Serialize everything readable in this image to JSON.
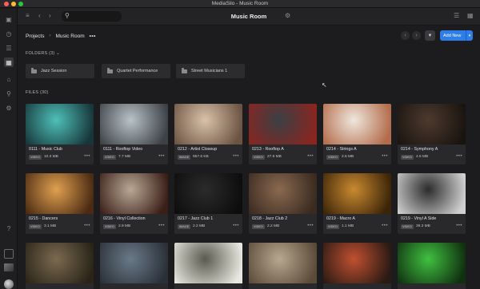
{
  "window": {
    "title": "MediaSilo - Music Room"
  },
  "topbar": {
    "room_title": "Music Room",
    "search_placeholder": ""
  },
  "breadcrumbs": {
    "items": [
      "Projects",
      "Music Room"
    ],
    "more": "•••"
  },
  "toolbar": {
    "add_new_label": "Add New"
  },
  "folders": {
    "header": "FOLDERS (3)",
    "items": [
      "Jazz Session",
      "Quartet Performance",
      "Street Musicians 1"
    ]
  },
  "files": {
    "header": "FILES (30)",
    "items": [
      {
        "title": "0111 - Music Club",
        "type": "VIDEO",
        "size": "10.3 MB",
        "colors": [
          "#4ec0b8",
          "#17363a"
        ]
      },
      {
        "title": "0111 - Rooftop Video",
        "type": "VIDEO",
        "size": "7.7 MB",
        "colors": [
          "#b9c3c8",
          "#3c4146"
        ]
      },
      {
        "title": "0212 - Artist Closeup",
        "type": "IMAGE",
        "size": "957.6 KB",
        "colors": [
          "#d9c2a8",
          "#6b5342"
        ]
      },
      {
        "title": "0213 - Rooftop A",
        "type": "VIDEO",
        "size": "27.6 MB",
        "colors": [
          "#3a4045",
          "#8a2520"
        ]
      },
      {
        "title": "0214 - Strings A",
        "type": "VIDEO",
        "size": "2.6 MB",
        "colors": [
          "#efe7dd",
          "#b36b4a"
        ]
      },
      {
        "title": "0214 - Symphony A",
        "type": "VIDEO",
        "size": "4.5 MB",
        "colors": [
          "#4d3a2e",
          "#1a1410"
        ]
      },
      {
        "title": "0215 - Dancers",
        "type": "VIDEO",
        "size": "3.1 MB",
        "colors": [
          "#e0a050",
          "#4a2a12"
        ]
      },
      {
        "title": "0216 - Vinyl Collection",
        "type": "VIDEO",
        "size": "2.9 MB",
        "colors": [
          "#b9a894",
          "#3a1e18"
        ]
      },
      {
        "title": "0217 - Jazz Club 1",
        "type": "IMAGE",
        "size": "2.2 MB",
        "colors": [
          "#2b2b2b",
          "#0d0d0d"
        ]
      },
      {
        "title": "0218 - Jazz Club 2",
        "type": "VIDEO",
        "size": "2.2 MB",
        "colors": [
          "#8a6a50",
          "#3a2a20"
        ]
      },
      {
        "title": "0219 - Macro A",
        "type": "VIDEO",
        "size": "1.1 MB",
        "colors": [
          "#c98a30",
          "#3c2408"
        ]
      },
      {
        "title": "0219 - Vinyl A Side",
        "type": "VIDEO",
        "size": "39.3 MB",
        "colors": [
          "#2c2c2c",
          "#d0d0d0"
        ]
      },
      {
        "title": "",
        "type": "",
        "size": "",
        "colors": [
          "#7a6a50",
          "#2a2418"
        ]
      },
      {
        "title": "",
        "type": "",
        "size": "",
        "colors": [
          "#6a7a88",
          "#2a3038"
        ]
      },
      {
        "title": "",
        "type": "",
        "size": "",
        "colors": [
          "#5a5a50",
          "#e8e8e0"
        ]
      },
      {
        "title": "",
        "type": "",
        "size": "",
        "colors": [
          "#b8a890",
          "#5a4a38"
        ]
      },
      {
        "title": "",
        "type": "",
        "size": "",
        "colors": [
          "#c05030",
          "#2a1a14"
        ]
      },
      {
        "title": "",
        "type": "",
        "size": "",
        "colors": [
          "#40c040",
          "#103010"
        ]
      }
    ]
  },
  "colors": {
    "accent": "#2f7de8",
    "background": "#1c1c1e",
    "card": "#29292c"
  }
}
